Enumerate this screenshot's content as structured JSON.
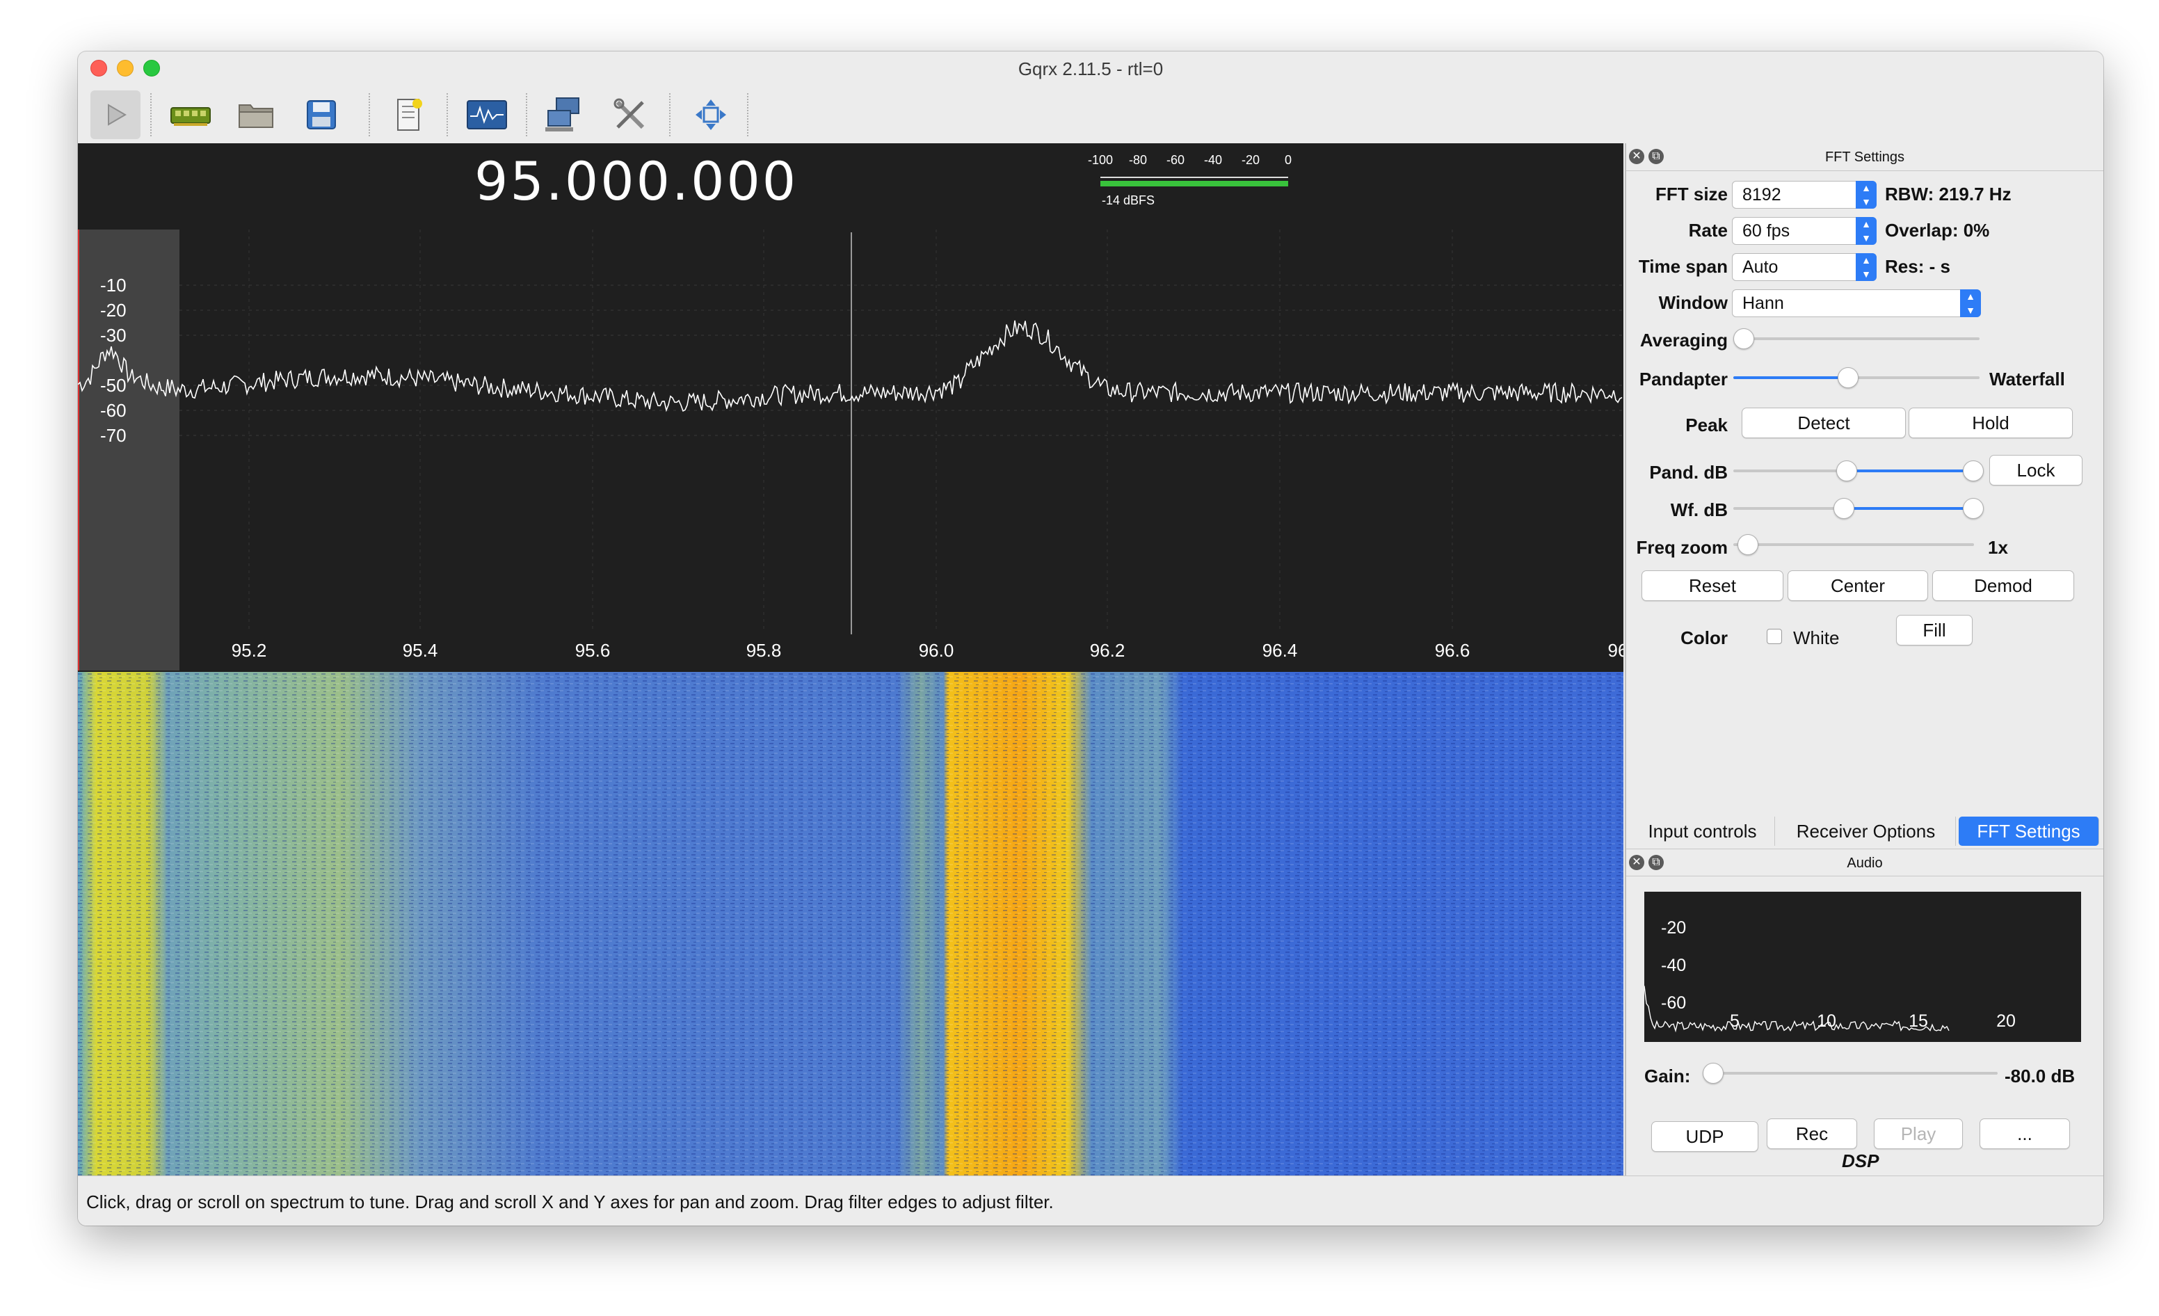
{
  "window": {
    "title": "Gqrx 2.11.5 - rtl=0"
  },
  "toolbar": {
    "buttons": [
      "play-icon",
      "device-icon",
      "open-folder-icon",
      "save-icon",
      "bookmark-icon",
      "waveform-icon",
      "network-icon",
      "tools-icon",
      "fullscreen-icon"
    ]
  },
  "main": {
    "frequency": "95.000.000",
    "meter": {
      "scale": [
        "-100",
        "-80",
        "-60",
        "-40",
        "-20",
        "0"
      ],
      "reading": "-14 dBFS",
      "level_dbfs": -14
    },
    "spectrum": {
      "y_labels": [
        "-10",
        "-20",
        "-30",
        "-50",
        "-60",
        "-70"
      ],
      "x_labels": [
        "95.2",
        "95.4",
        "95.6",
        "95.8",
        "96.0",
        "96.2",
        "96.4",
        "96.6",
        "96"
      ]
    }
  },
  "fft_settings": {
    "header": "FFT Settings",
    "fft_size_label": "FFT size",
    "fft_size_value": "8192",
    "rbw": "RBW: 219.7 Hz",
    "rate_label": "Rate",
    "rate_value": "60 fps",
    "overlap": "Overlap: 0%",
    "time_span_label": "Time span",
    "time_span_value": "Auto",
    "res": "Res: - s",
    "window_label": "Window",
    "window_value": "Hann",
    "averaging_label": "Averaging",
    "pandapter_label": "Pandapter",
    "waterfall_label": "Waterfall",
    "peak_label": "Peak",
    "detect_button": "Detect",
    "hold_button": "Hold",
    "pand_db_label": "Pand. dB",
    "lock_button": "Lock",
    "wf_db_label": "Wf. dB",
    "freq_zoom_label": "Freq zoom",
    "freq_zoom_value": "1x",
    "reset_button": "Reset",
    "center_button": "Center",
    "demod_button": "Demod",
    "color_label": "Color",
    "white_label": "White",
    "fill_button": "Fill"
  },
  "tabs": [
    "Input controls",
    "Receiver Options",
    "FFT Settings"
  ],
  "audio": {
    "header": "Audio",
    "y_labels": [
      "-20",
      "-40",
      "-60"
    ],
    "x_labels": [
      "5",
      "10",
      "15",
      "20"
    ],
    "gain_label": "Gain:",
    "gain_value": "-80.0 dB",
    "udp_button": "UDP",
    "rec_button": "Rec",
    "play_button": "Play",
    "more_button": "...",
    "dsp_label": "DSP"
  },
  "status": "Click, drag or scroll on spectrum to tune. Drag and scroll X and Y axes for pan and zoom. Drag filter edges to adjust filter.",
  "colors": {
    "accent": "#2d7cf6",
    "plot_bg": "#1f1f1f",
    "waterfall_blue": "#3a6ad8",
    "waterfall_peak": "#f7b20f"
  }
}
